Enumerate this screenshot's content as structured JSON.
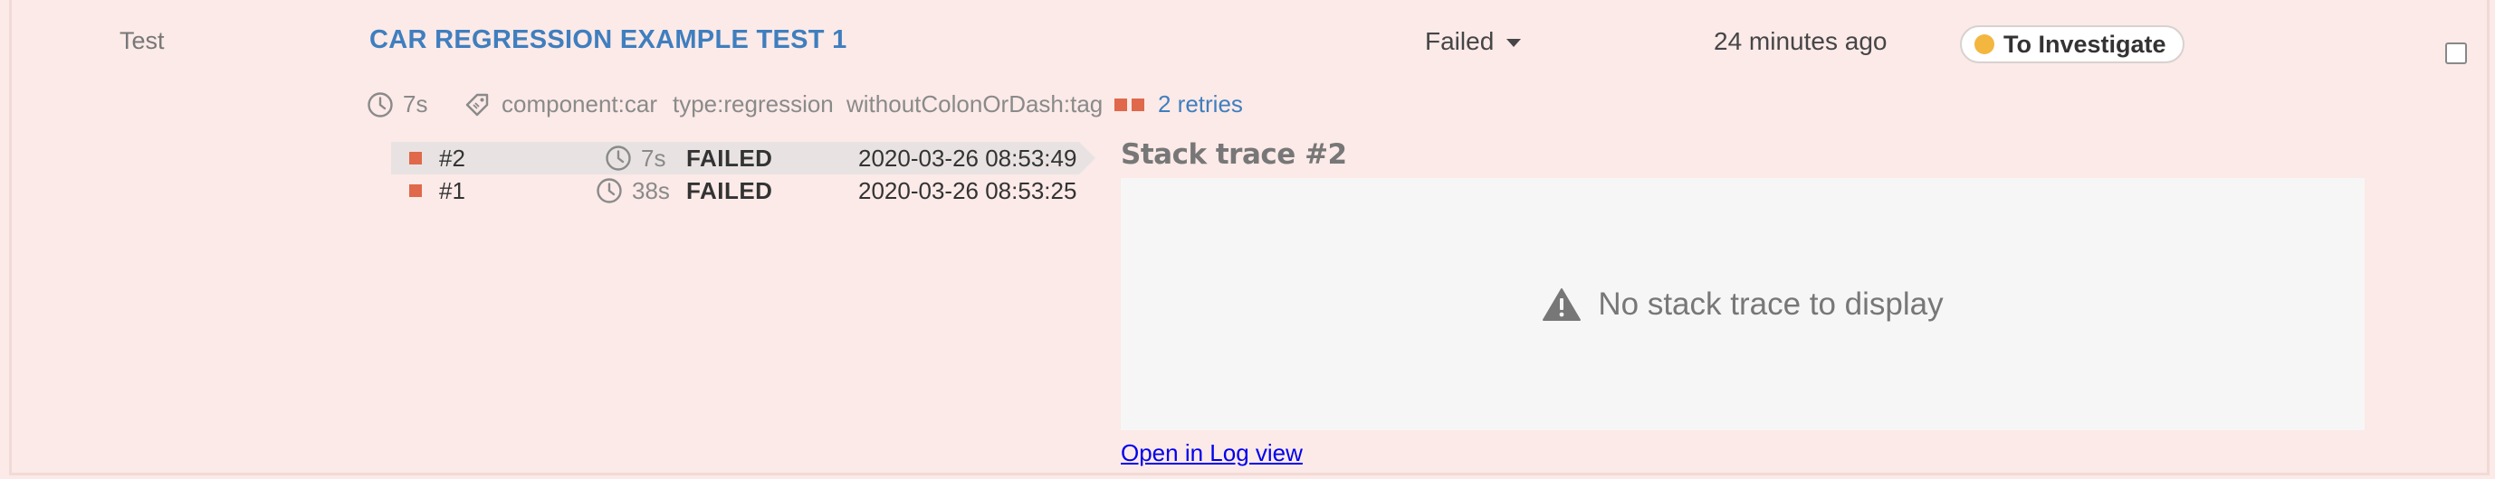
{
  "item": {
    "type_label": "Test",
    "name": "CAR REGRESSION EXAMPLE TEST 1",
    "status": "Failed",
    "time_ago": "24 minutes ago",
    "defect_type": "To Investigate",
    "defect_color": "#f3b63f",
    "duration": "7s",
    "attributes": [
      "component:car",
      "type:regression",
      "withoutColonOrDash:tag"
    ],
    "retries_label": "2 retries",
    "status_color": "#e0684b",
    "link_color": "#3f7ebf"
  },
  "retries": [
    {
      "number": "#2",
      "duration": "7s",
      "status": "FAILED",
      "date": "2020-03-26 08:53:49",
      "active": true
    },
    {
      "number": "#1",
      "duration": "38s",
      "status": "FAILED",
      "date": "2020-03-26 08:53:25",
      "active": false
    }
  ],
  "stack_trace": {
    "title": "Stack trace #2",
    "empty_message": "No stack trace to display",
    "open_log_link": "Open in Log view"
  },
  "icons": [
    "clock-icon",
    "tag-icon",
    "retry-squares-icon",
    "caret-down-icon",
    "warning-icon"
  ]
}
